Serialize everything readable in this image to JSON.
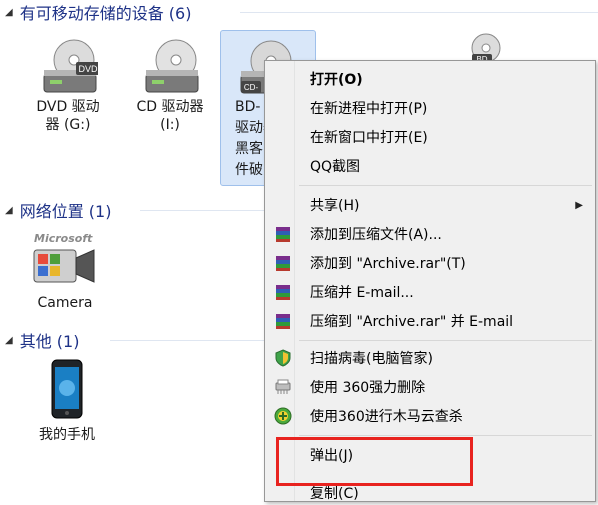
{
  "groups": [
    {
      "label": "有可移动存储的设备 (6)"
    },
    {
      "label": "网络位置 (1)"
    },
    {
      "label": "其他 (1)"
    }
  ],
  "drives": [
    {
      "label": "DVD 驱动\n器 (G:)",
      "badge": "DVD"
    },
    {
      "label": "CD 驱动器\n(I:)"
    },
    {
      "label": "BD-\n驱动器\n黑客\n件破",
      "badge": "CD-"
    },
    {
      "badge": "BD"
    }
  ],
  "network": [
    {
      "label": "Camera",
      "logo": "Microsoft"
    }
  ],
  "others": [
    {
      "label": "我的手机"
    }
  ],
  "context_menu": {
    "items": [
      {
        "label": "打开(O)",
        "bold": true
      },
      {
        "label": "在新进程中打开(P)"
      },
      {
        "label": "在新窗口中打开(E)"
      },
      {
        "label": "QQ截图"
      },
      {
        "label": "共享(H)"
      },
      {
        "label": "添加到压缩文件(A)...",
        "icon": "winrar-icon"
      },
      {
        "label": "添加到 \"Archive.rar\"(T)",
        "icon": "winrar-icon"
      },
      {
        "label": "压缩并 E-mail...",
        "icon": "winrar-icon"
      },
      {
        "label": "压缩到 \"Archive.rar\" 并 E-mail",
        "icon": "winrar-icon"
      },
      {
        "label": "扫描病毒(电脑管家)",
        "icon": "shield-icon"
      },
      {
        "label": "使用 360强力删除",
        "icon": "shredder-icon"
      },
      {
        "label": "使用360进行木马云查杀",
        "icon": "360-icon"
      },
      {
        "label": "弹出(J)"
      },
      {
        "label": "复制(C)"
      }
    ]
  },
  "colors": {
    "accent": "#1e3287",
    "highlight_box": "#e8231f"
  }
}
